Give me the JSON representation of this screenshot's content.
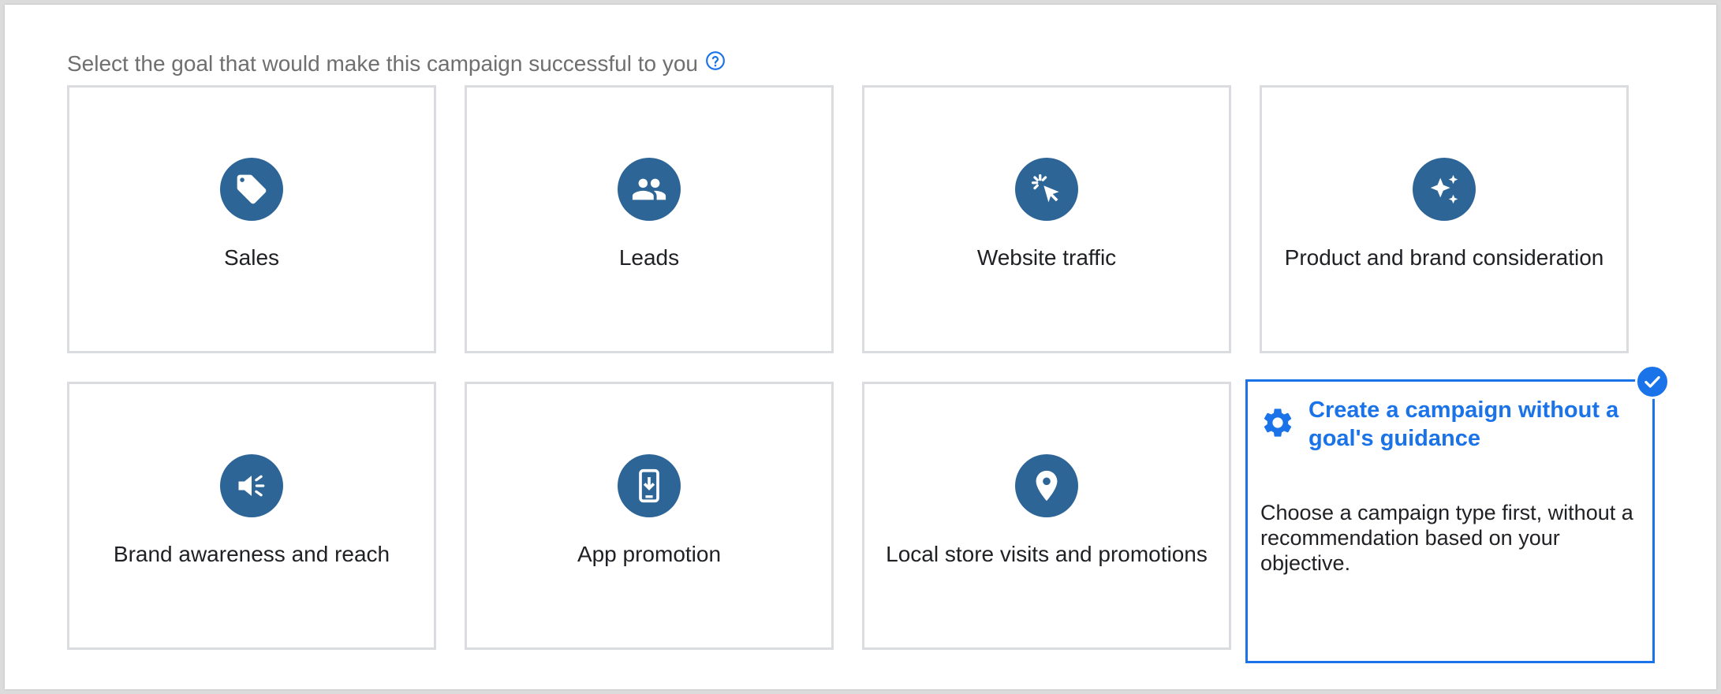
{
  "prompt": {
    "text": "Select the goal that would make this campaign successful to you",
    "help_icon": "help-circle-icon"
  },
  "goals": [
    {
      "label": "Sales",
      "icon": "tag-icon"
    },
    {
      "label": "Leads",
      "icon": "people-icon"
    },
    {
      "label": "Website traffic",
      "icon": "cursor-click-icon"
    },
    {
      "label": "Product and brand consideration",
      "icon": "sparkle-icon"
    },
    {
      "label": "Brand awareness and reach",
      "icon": "megaphone-icon"
    },
    {
      "label": "App promotion",
      "icon": "phone-download-icon"
    },
    {
      "label": "Local store visits and promotions",
      "icon": "location-pin-icon"
    }
  ],
  "no_goal": {
    "title": "Create a campaign without a goal's guidance",
    "description": "Choose a campaign type first, without a recommendation based on your objective.",
    "icon": "gear-icon",
    "selected": true,
    "selected_icon": "checkmark-icon"
  },
  "colors": {
    "icon_circle": "#2d6597",
    "accent": "#1a73e8",
    "card_border": "#dadce0",
    "prompt_text": "#6f6f6f"
  }
}
